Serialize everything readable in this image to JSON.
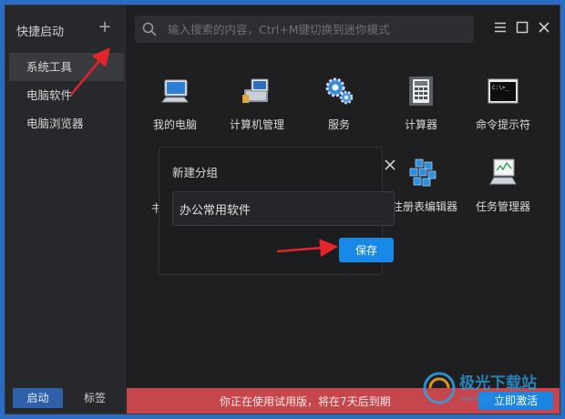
{
  "sidebar": {
    "header": "快捷启动",
    "add_symbol": "+",
    "items": [
      {
        "label": "系统工具",
        "active": true
      },
      {
        "label": "电脑软件",
        "active": false
      },
      {
        "label": "电脑浏览器",
        "active": false
      }
    ],
    "footer": {
      "start_label": "启动",
      "tag_label": "标签"
    }
  },
  "search": {
    "placeholder": "输入搜索的内容，Ctrl+M键切换到迷你模式",
    "value": ""
  },
  "window_controls": [
    "menu-icon",
    "maximize-icon",
    "close-icon"
  ],
  "tiles_row1": [
    {
      "label": "我的电脑",
      "icon": "computer-icon"
    },
    {
      "label": "计算机管理",
      "icon": "computer-management-icon"
    },
    {
      "label": "服务",
      "icon": "gears-icon"
    },
    {
      "label": "计算器",
      "icon": "calculator-icon"
    },
    {
      "label": "命令提示符",
      "icon": "terminal-icon"
    }
  ],
  "tiles_row2": [
    {
      "label": "注册表编辑器",
      "icon": "registry-icon"
    },
    {
      "label": "任务管理器",
      "icon": "task-manager-icon"
    }
  ],
  "dialog": {
    "title": "新建分组",
    "input_value": "办公常用软件",
    "save_label": "保存"
  },
  "trial_bar": {
    "text": "你正在使用试用版，将在7天后到期",
    "activate_label": "立即激活"
  },
  "colors": {
    "background": "#1f1f21",
    "sidebar": "#27282b",
    "accent": "#1889e6",
    "trial_bar": "#c5474d",
    "annotation_arrow": "#e2262b"
  }
}
